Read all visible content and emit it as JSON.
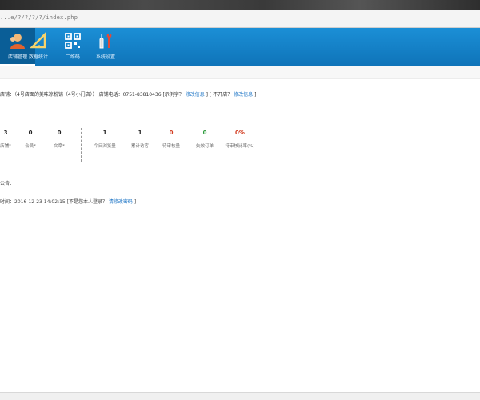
{
  "browser": {
    "url": "...e/?/?/?/?/index.php"
  },
  "nav": {
    "items": [
      {
        "label": "店铺管理",
        "icon": "users-icon"
      },
      {
        "label": "数据统计",
        "icon": "ruler-triangle-icon"
      },
      {
        "label": "二维码",
        "icon": "qr-code-icon"
      },
      {
        "label": "系统设置",
        "icon": "tools-icon"
      }
    ]
  },
  "shop": {
    "text": "店铺：（4号店面的美味凉粉铺（4号小门店））",
    "phone_text": "店铺电话：0751-83810436",
    "question": "[示例字？",
    "link1": "修改信息",
    "sep": "] [",
    "not_open": "不开店？",
    "link2": "修改信息",
    "end": "]"
  },
  "stats": [
    {
      "value": "3",
      "label": "店铺*"
    },
    {
      "value": "0",
      "label": "会员*"
    },
    {
      "value": "0",
      "label": "文章*"
    },
    {
      "value": "1",
      "label": "今日浏览量"
    },
    {
      "value": "1",
      "label": "累计访客"
    },
    {
      "value": "0",
      "label": "待审核量"
    },
    {
      "value": "0",
      "label": "失效订单"
    },
    {
      "value": "0%",
      "label": "待审核比率(%)"
    }
  ],
  "colors": {
    "accent": "#1b8fd6",
    "value_red": "#d23b1f",
    "value_green": "#2a9a3a"
  },
  "notice": "公告：",
  "login": {
    "text": "时间：2016-12-23 14:02:15",
    "question": "[不是您本人登录？",
    "link": "请修改密码",
    "end": "]"
  }
}
